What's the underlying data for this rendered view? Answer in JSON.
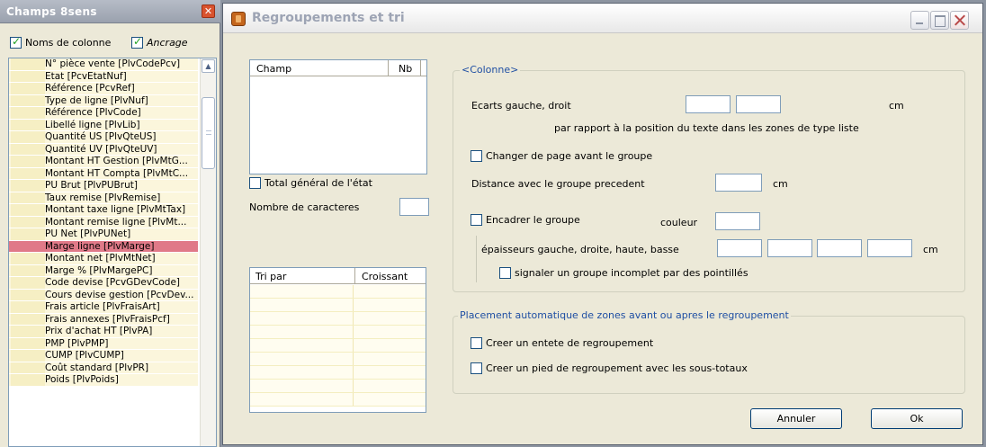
{
  "left_panel": {
    "title": "Champs 8sens",
    "show_column_names": {
      "label": "Noms de colonne",
      "checked": true
    },
    "anchoring": {
      "label": "Ancrage",
      "checked": true
    },
    "items": [
      "N° pièce vente [PlvCodePcv]",
      "Etat [PcvEtatNuf]",
      "Référence [PcvRef]",
      "Type de ligne [PlvNuf]",
      "Référence [PlvCode]",
      "Libellé ligne [PlvLib]",
      "Quantité US [PlvQteUS]",
      "Quantité UV [PlvQteUV]",
      "Montant HT Gestion [PlvMtG...",
      "Montant HT Compta [PlvMtC...",
      "PU Brut [PlvPUBrut]",
      "Taux remise [PlvRemise]",
      "Montant taxe ligne [PlvMtTax]",
      "Montant remise ligne [PlvMt...",
      "PU Net [PlvPUNet]",
      "Marge ligne [PlvMarge]",
      "Montant net [PlvMtNet]",
      "Marge % [PlvMargePC]",
      "Code devise [PcvGDevCode]",
      "Cours devise gestion [PcvDev...",
      "Frais article [PlvFraisArt]",
      "Frais annexes [PlvFraisPcf]",
      "Prix d'achat HT [PlvPA]",
      "PMP [PlvPMP]",
      "CUMP [PlvCUMP]",
      "Coût standard [PlvPR]",
      "Poids [PlvPoids]"
    ],
    "selected_item": "Marge ligne [PlvMarge]"
  },
  "dialog": {
    "title": "Regroupements et tri",
    "fields_grid": {
      "col_field": "Champ",
      "col_nb": "Nb"
    },
    "grand_total": {
      "label": "Total général de l'état",
      "checked": false
    },
    "char_count_label": "Nombre de caracteres",
    "sort_grid": {
      "col_sort": "Tri par",
      "col_asc": "Croissant"
    },
    "column_group": {
      "legend": "<Colonne>",
      "margins_label": "Ecarts gauche, droit",
      "margins_unit": "cm",
      "margins_note": "par rapport à la position du texte dans les zones de type liste",
      "page_break": {
        "label": "Changer de page avant le groupe",
        "checked": false
      },
      "distance_label": "Distance avec le groupe precedent",
      "distance_unit": "cm",
      "frame": {
        "label": "Encadrer le groupe",
        "checked": false
      },
      "color_label": "couleur",
      "thickness_label": "épaisseurs gauche, droite, haute, basse",
      "thickness_unit": "cm",
      "incomplete": {
        "label": "signaler un groupe incomplet par des pointillés",
        "checked": false
      }
    },
    "auto_group": {
      "legend": "Placement automatique de zones avant ou apres le regroupement",
      "header": {
        "label": "Creer un entete de regroupement",
        "checked": false
      },
      "footer": {
        "label": "Creer un pied de regroupement avec les sous-totaux",
        "checked": false
      }
    },
    "cancel_label": "Annuler",
    "ok_label": "Ok"
  }
}
